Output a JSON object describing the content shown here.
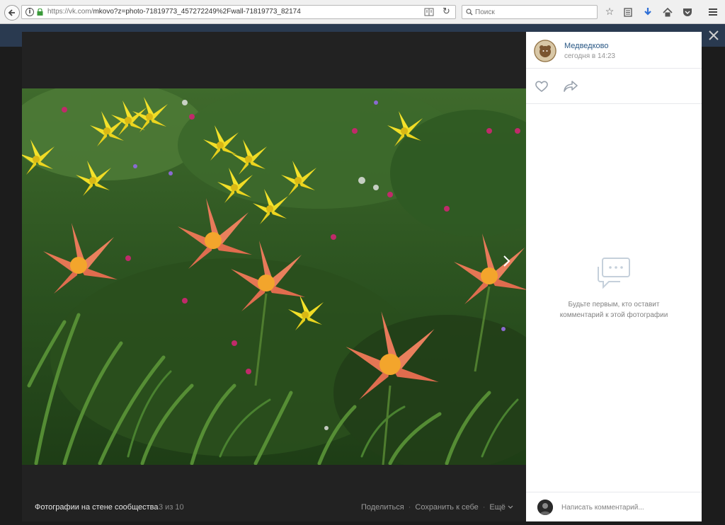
{
  "browser": {
    "url_main": "https://vk.com/",
    "url_path": "mkovo?z=photo-71819773_457272249%2Fwall-71819773_82174",
    "search_placeholder": "Поиск"
  },
  "viewer": {
    "album_title": "Фотографии на стене сообщества",
    "counter": "3 из 10",
    "actions": {
      "share": "Поделиться",
      "save": "Сохранить к себе",
      "more": "Ещё"
    },
    "separator": "·"
  },
  "sidebar": {
    "owner_name": "Медведково",
    "owner_time": "сегодня в 14:23",
    "empty_line1": "Будьте первым, кто оставит",
    "empty_line2": "комментарий к этой фотографии",
    "comment_placeholder": "Написать комментарий..."
  },
  "colors": {
    "link": "#2a5885",
    "muted": "#828282",
    "viewer_bg": "#222222"
  },
  "icons": [
    "back-arrow-icon",
    "info-icon",
    "lock-icon",
    "reader-icon",
    "reload-icon",
    "search-icon",
    "bookmark-star-icon",
    "reading-list-icon",
    "download-icon",
    "home-icon",
    "pocket-icon",
    "menu-icon",
    "heart-icon",
    "share-icon",
    "comment-bubble-icon",
    "next-arrow-icon",
    "close-icon",
    "chevron-down-icon"
  ]
}
